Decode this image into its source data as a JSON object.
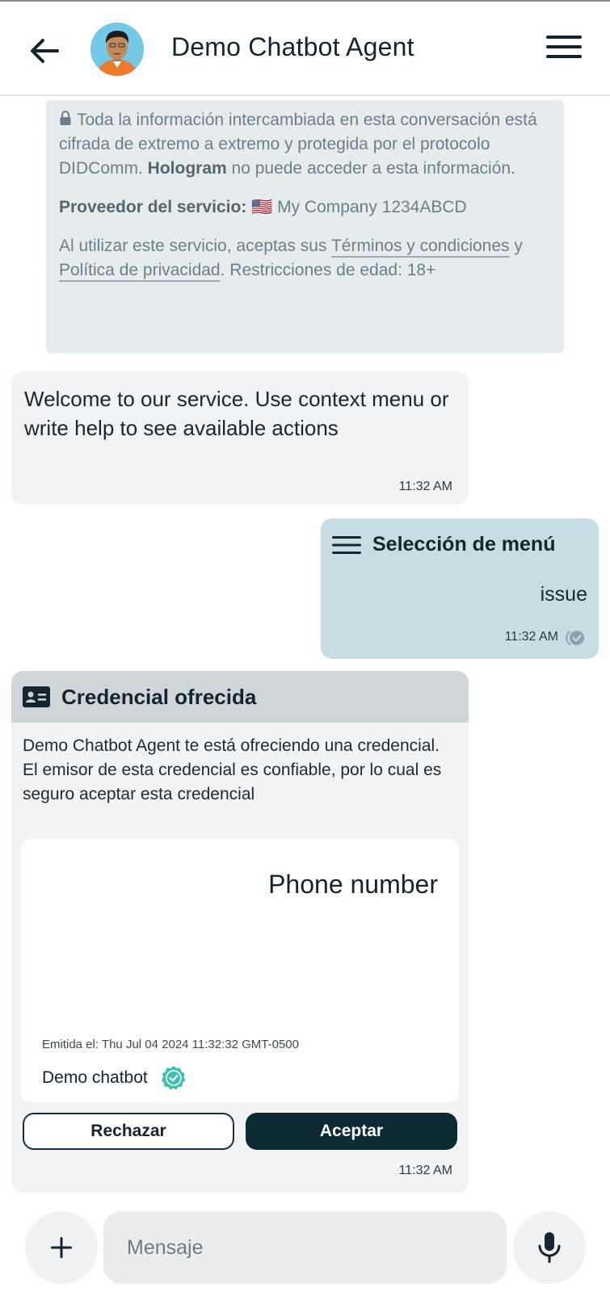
{
  "header": {
    "title": "Demo Chatbot Agent",
    "back_icon": "arrow-left-icon",
    "menu_icon": "hamburger-menu-icon"
  },
  "info": {
    "p1_part1": "Toda la información intercambiada en esta conversación está cifrada de extremo a extremo y protegida por el protocolo DIDComm. ",
    "p1_bold": "Hologram",
    "p1_part2": " no puede acceder a esta información.",
    "provider_label": "Proveedor del servicio:",
    "provider_flag": "🇺🇸",
    "provider_name": "My Company 1234ABCD",
    "terms_prefix": "Al utilizar este servicio, aceptas sus ",
    "terms_link": "Términos y condiciones",
    "terms_and": " y ",
    "privacy_link": "Política de privacidad",
    "terms_suffix": ". Restricciones de edad: 18+"
  },
  "messages": {
    "welcome": {
      "text": "Welcome to our service. Use context menu or write help to see available actions",
      "time": "11:32 AM"
    },
    "menu_selection": {
      "label": "Selección de menú",
      "value": "issue",
      "time": "11:32 AM"
    },
    "credential": {
      "header": "Credencial ofrecida",
      "description": "Demo Chatbot Agent te está ofreciendo una credencial. El emisor de esta credencial es confiable, por lo cual es seguro aceptar esta credencial",
      "card_name": "Phone number",
      "issued": "Emitida el: Thu Jul 04 2024 11:32:32 GMT-0500",
      "issuer": "Demo chatbot",
      "reject_label": "Rechazar",
      "accept_label": "Aceptar",
      "time": "11:32 AM"
    }
  },
  "composer": {
    "placeholder": "Mensaje",
    "add_icon": "plus-icon",
    "mic_icon": "microphone-icon"
  },
  "colors": {
    "accent": "#0c2a34",
    "info_bg": "#e6ecee",
    "outgoing_bg": "#c7dde4",
    "verified": "#3cc0b0"
  }
}
